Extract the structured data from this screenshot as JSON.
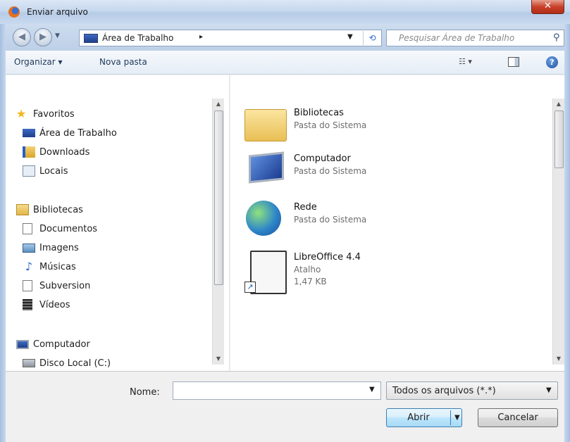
{
  "window": {
    "title": "Enviar arquivo",
    "close_label": "x"
  },
  "nav": {
    "address": "Área de Trabalho",
    "address_separator": "▸",
    "search_placeholder": "Pesquisar Área de Trabalho"
  },
  "toolbar": {
    "organize_label": "Organizar ▾",
    "new_folder_label": "Nova pasta",
    "help_label": "?"
  },
  "sidebar": {
    "favorites_label": "Favoritos",
    "favorites": [
      {
        "label": "Área de Trabalho",
        "icon": "desktop-icon"
      },
      {
        "label": "Downloads",
        "icon": "downloads-icon"
      },
      {
        "label": "Locais",
        "icon": "recent-places-icon"
      }
    ],
    "libraries_label": "Bibliotecas",
    "libraries": [
      {
        "label": "Documentos",
        "icon": "documents-icon"
      },
      {
        "label": "Imagens",
        "icon": "pictures-icon"
      },
      {
        "label": "Músicas",
        "icon": "music-icon"
      },
      {
        "label": "Subversion",
        "icon": "subversion-icon"
      },
      {
        "label": "Vídeos",
        "icon": "videos-icon"
      }
    ],
    "computer_label": "Computador",
    "computer": [
      {
        "label": "Disco Local (C:)",
        "icon": "local-disk-icon"
      }
    ]
  },
  "files": [
    {
      "name": "Bibliotecas",
      "sub1": "Pasta do Sistema",
      "sub2": "",
      "icon": "libraries-folder-icon"
    },
    {
      "name": "Computador",
      "sub1": "Pasta do Sistema",
      "sub2": "",
      "icon": "computer-icon"
    },
    {
      "name": "Rede",
      "sub1": "Pasta do Sistema",
      "sub2": "",
      "icon": "network-icon"
    },
    {
      "name": "LibreOffice 4.4",
      "sub1": "Atalho",
      "sub2": "1,47 KB",
      "icon": "libreoffice-shortcut-icon"
    }
  ],
  "bottom": {
    "name_label": "Nome:",
    "name_value": "",
    "filter_value": "Todos os arquivos (*.*)",
    "open_label": "Abrir",
    "cancel_label": "Cancelar"
  }
}
